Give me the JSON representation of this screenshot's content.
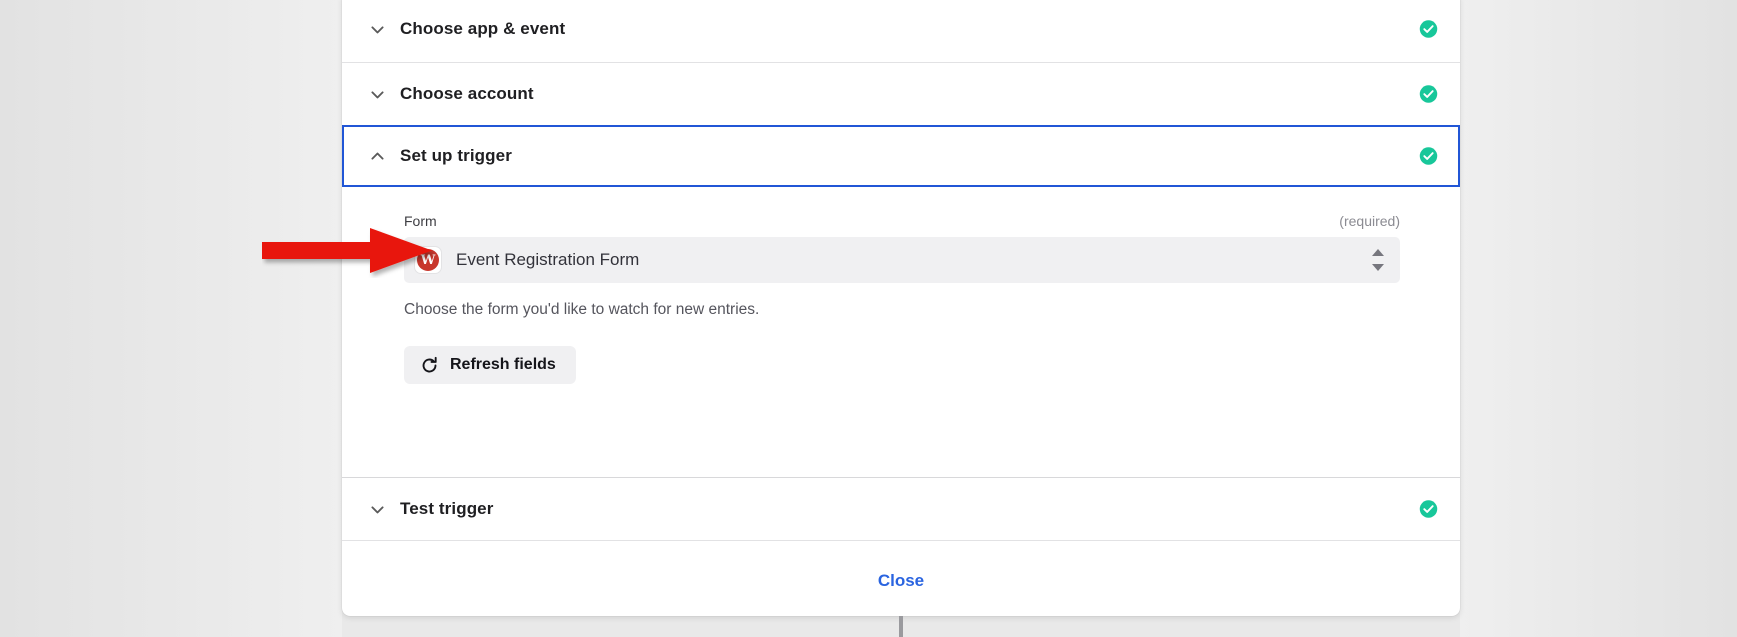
{
  "window": {
    "background_color": "#e9e9e9",
    "card_background": "#ffffff"
  },
  "colors": {
    "accent_blue": "#2156d6",
    "link_blue": "#2a64e0",
    "success_green": "#18c79a",
    "annotation_red": "#e8160c",
    "app_icon_red": "#c8372d"
  },
  "steps": [
    {
      "id": "choose-app-event",
      "title": "Choose app & event",
      "expanded": false,
      "chevron": "chevron-down-icon",
      "status": "complete",
      "status_icon": "check-circle-icon"
    },
    {
      "id": "choose-account",
      "title": "Choose account",
      "expanded": false,
      "chevron": "chevron-down-icon",
      "status": "complete",
      "status_icon": "check-circle-icon"
    },
    {
      "id": "set-up-trigger",
      "title": "Set up trigger",
      "expanded": true,
      "chevron": "chevron-up-icon",
      "status": "complete",
      "status_icon": "check-circle-icon"
    },
    {
      "id": "test-trigger",
      "title": "Test trigger",
      "expanded": false,
      "chevron": "chevron-down-icon",
      "status": "complete",
      "status_icon": "check-circle-icon"
    }
  ],
  "trigger_panel": {
    "field": {
      "label": "Form",
      "required_text": "(required)",
      "selected_value": "Event Registration Form",
      "app_icon_letter": "W",
      "app_icon_name": "wufoo-app-icon",
      "dropdown_icon": "up-down-stepper-icon",
      "help_text": "Choose the form you'd like to watch for new entries."
    },
    "refresh_button": {
      "label": "Refresh fields",
      "icon": "refresh-icon"
    }
  },
  "footer": {
    "close_label": "Close"
  },
  "annotation": {
    "type": "arrow",
    "direction": "right",
    "color": "#e8160c",
    "points_at": "form-select-field"
  }
}
